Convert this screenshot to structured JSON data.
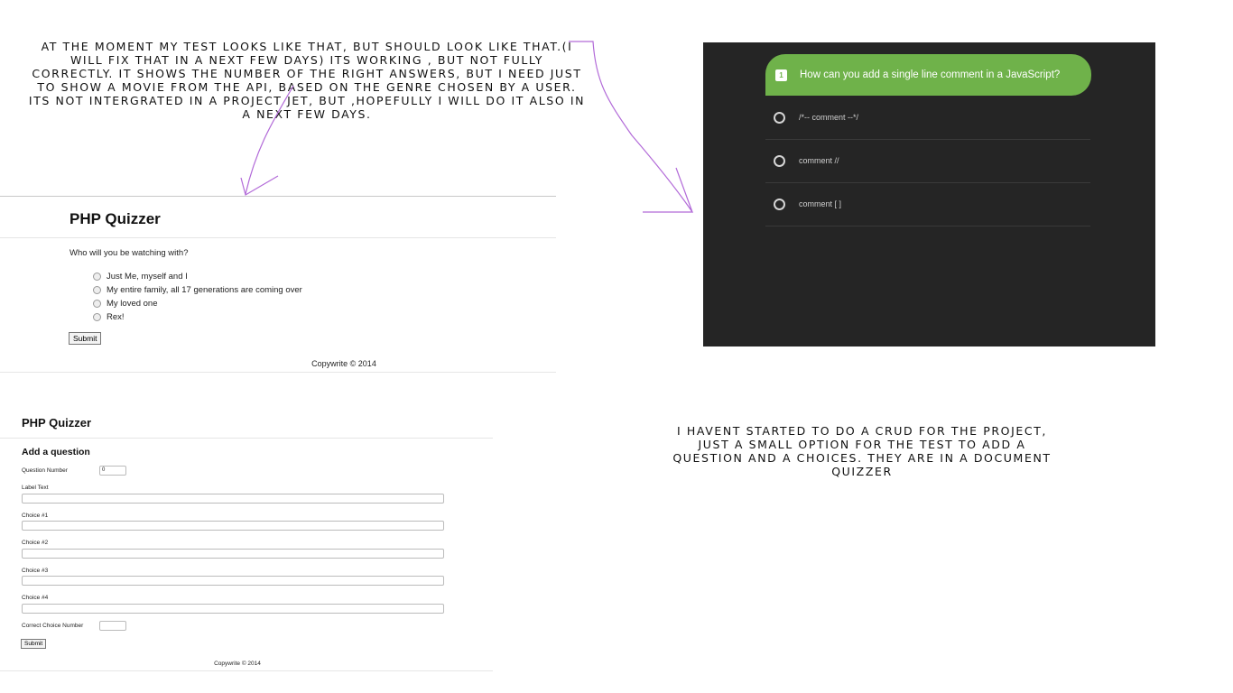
{
  "notes": {
    "top": "At the moment my test looks like that, but should look like that.(I will fix that in a next few days) its working , but not fully correctly. It shows the number of the right answers, but I need just to show a movie from the api, based on the genre chosen by a user. Its not intergrated in a project jet, but ,hopefully I will do it also in a next few days.",
    "bottom": "I havent started to do a crud for the project, just a small option for the test to add a question and a choices. They are in a document quizzer"
  },
  "quiz_panel": {
    "title": "PHP Quizzer",
    "question": "Who will you be watching with?",
    "choices": [
      "Just Me, myself and I",
      "My entire family, all 17 generations are coming over",
      "My loved one",
      "Rex!"
    ],
    "submit_label": "Submit",
    "footer": "Copywrite © 2014"
  },
  "design_panel": {
    "question_number": "1",
    "question": "How can you add a single line comment in a JavaScript?",
    "options": [
      "/*-- comment --*/",
      "comment //",
      "comment [ ]"
    ],
    "colors": {
      "background": "#252525",
      "accent": "#6fb24a"
    }
  },
  "admin_panel": {
    "title": "PHP Quizzer",
    "heading": "Add a question",
    "question_number_label": "Question Number",
    "question_number_value": "0",
    "label_text_label": "Label Text",
    "choice1_label": "Choice #1",
    "choice2_label": "Choice #2",
    "choice3_label": "Choice #3",
    "choice4_label": "Choice #4",
    "correct_choice_label": "Correct Choice Number",
    "submit_label": "Submit",
    "footer": "Copywrite © 2014"
  },
  "annotation_color": "#b26ad8"
}
